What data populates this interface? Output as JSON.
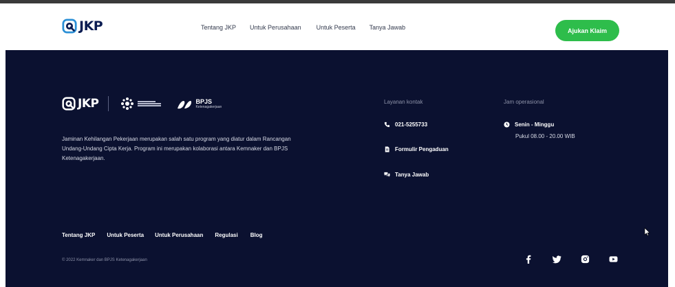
{
  "header": {
    "logo_text": "JKP",
    "nav": [
      "Tentang JKP",
      "Untuk Perusahaan",
      "Untuk Peserta",
      "Tanya Jawab"
    ],
    "cta_label": "Ajukan Klaim",
    "cta_color": "#2ebd4b"
  },
  "footer": {
    "background": "#0b1130",
    "logo_text": "JKP",
    "bpjs_title": "BPJS",
    "bpjs_subtitle": "Ketenagakerjaan",
    "description": "Jaminan Kehilangan Pekerjaan merupakan salah satu program yang diatur dalam Rancangan Undang-Undang Cipta Kerja. Program ini merupakan kolaborasi antara Kemnaker dan BPJS Ketenagakerjaan.",
    "contact": {
      "title": "Layanan kontak",
      "phone": "021-5255733",
      "complaint_form": "Formulir Pengaduan",
      "faq": "Tanya Jawab"
    },
    "hours": {
      "title": "Jam operasional",
      "days": "Senin - Minggu",
      "time": "Pukul 08.00 - 20.00 WIB"
    },
    "links": [
      "Tentang JKP",
      "Untuk Peserta",
      "Untuk Perusahaan",
      "Regulasi",
      "Blog"
    ],
    "copyright": "© 2022 Kemnaker dan BPJS Ketenagakerjaan",
    "socials": [
      "facebook-icon",
      "twitter-icon",
      "instagram-icon",
      "youtube-icon"
    ]
  }
}
